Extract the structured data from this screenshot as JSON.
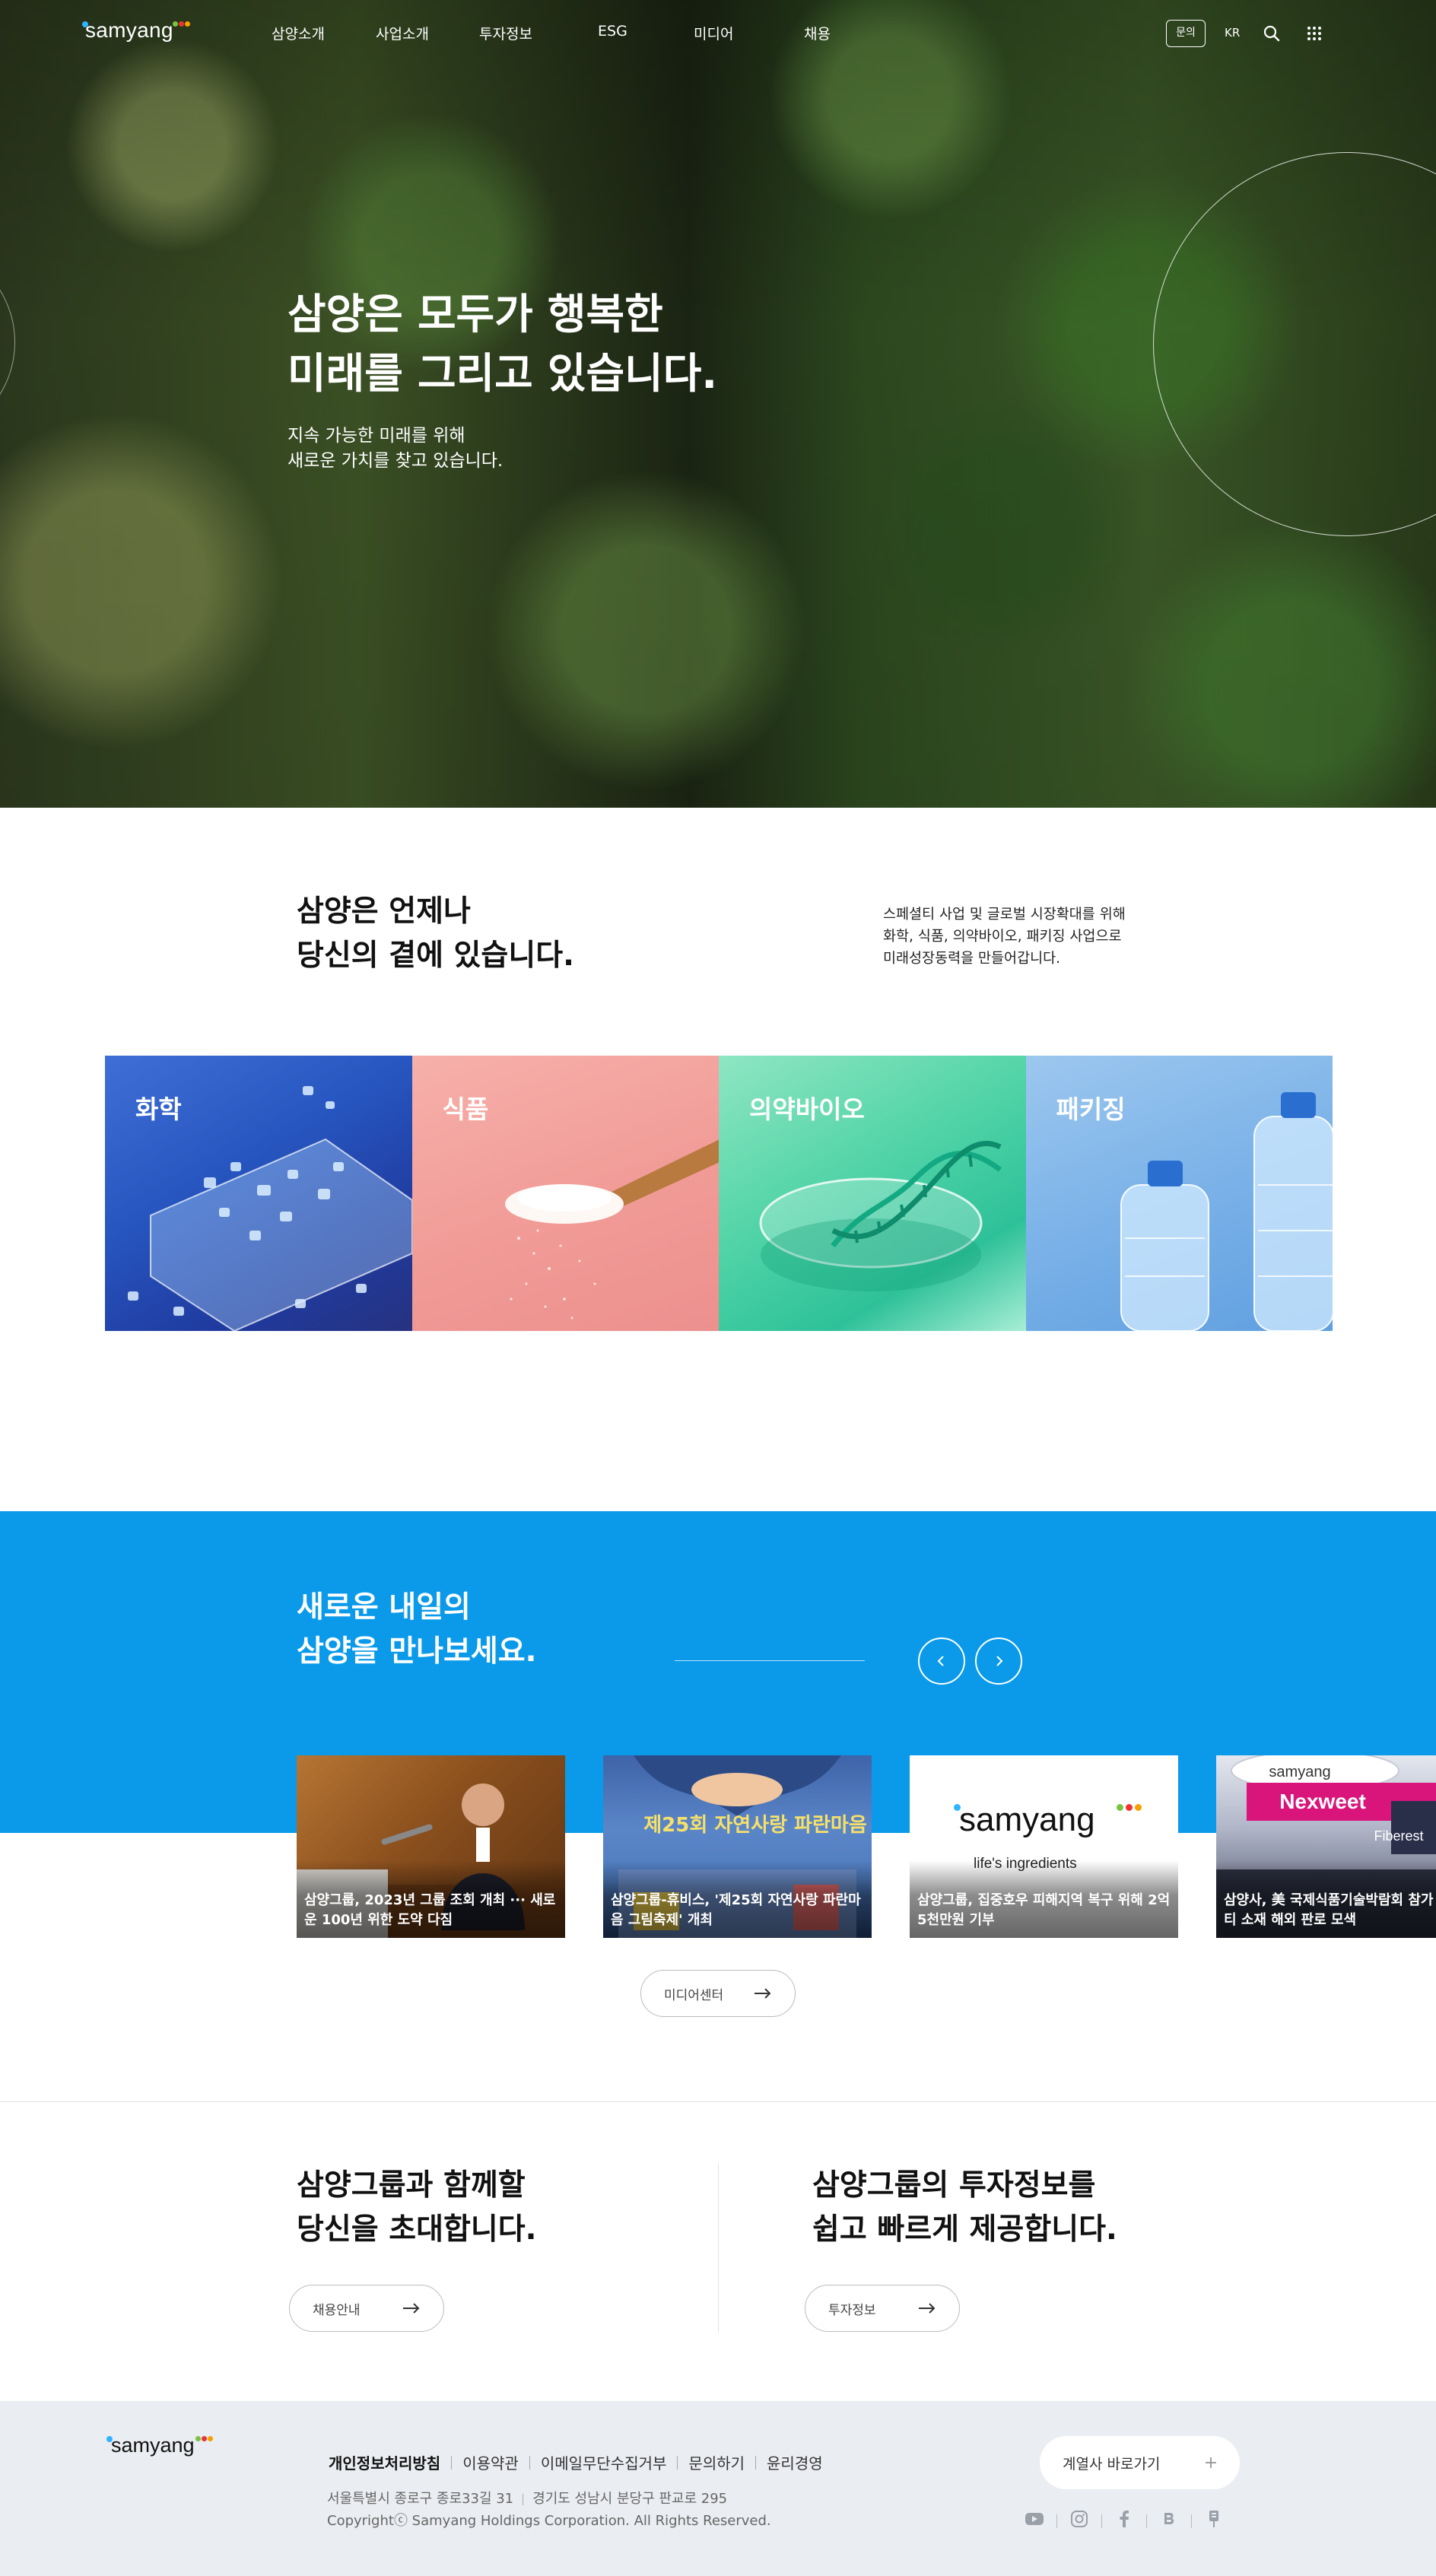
{
  "brand": {
    "logo_text": "samyang",
    "footer_logo_text": "samyang"
  },
  "nav": {
    "items": [
      "삼양소개",
      "사업소개",
      "투자정보",
      "ESG",
      "미디어",
      "채용"
    ],
    "inquiry_label": "문의",
    "lang_label": "KR",
    "search_icon": "search-icon",
    "menu_icon": "grid-menu-icon"
  },
  "hero": {
    "title_line1": "삼양은 모두가 행복한",
    "title_line2": "미래를 그리고 있습니다.",
    "sub_line1": "지속 가능한 미래를 위해",
    "sub_line2": "새로운 가치를 찾고 있습니다."
  },
  "about": {
    "title_line1": "삼양은 언제나",
    "title_line2": "당신의 곁에 있습니다.",
    "desc_line1": "스페셜티 사업 및 글로벌 시장확대를 위해",
    "desc_line2": "화학, 식품, 의약바이오, 패키징 사업으로",
    "desc_line3": "미래성장동력을 만들어갑니다."
  },
  "business": [
    {
      "label": "화학"
    },
    {
      "label": "식품"
    },
    {
      "label": "의약바이오"
    },
    {
      "label": "패키징"
    }
  ],
  "media": {
    "title_line1": "새로운 내일의",
    "title_line2": "삼양을 만나보세요.",
    "news": [
      {
        "caption": "삼양그룹, 2023년 그룹 조회 개최 ··· 새로운 100년 위한 도약 다짐"
      },
      {
        "caption": "삼양그룹-휴비스, '제25회 자연사랑 파란마음 그림축제' 개최",
        "image_text": "제25회 자연사랑 파란마음"
      },
      {
        "caption": "삼양그룹, 집중호우 피해지역 복구 위해 2억5천만원 기부",
        "image_logo": "samyang",
        "image_tagline": "life's ingredients"
      },
      {
        "caption": "삼양사, 美 국제식품기술박람회 참가 스페셜티 소재 해외 판로 모색",
        "image_text_1": "samyang",
        "image_text_2": "Nexweet",
        "image_text_3": "Fiberest"
      }
    ],
    "center_button": "미디어센터"
  },
  "invite": {
    "recruit_title_line1": "삼양그룹과 함께할",
    "recruit_title_line2": "당신을 초대합니다.",
    "recruit_button": "채용안내",
    "ir_title_line1": "삼양그룹의 투자정보를",
    "ir_title_line2": "쉽고 빠르게 제공합니다.",
    "ir_button": "투자정보"
  },
  "footer": {
    "links": [
      "개인정보처리방침",
      "이용약관",
      "이메일무단수집거부",
      "문의하기",
      "윤리경영"
    ],
    "address_1": "서울특별시 종로구 종로33길 31",
    "address_2": "경기도 성남시 분당구 판교로 295",
    "copyright": "Copyrightⓒ Samyang Holdings Corporation. All Rights Reserved.",
    "family_label": "계열사 바로가기",
    "social": [
      "youtube-icon",
      "instagram-icon",
      "facebook-icon",
      "blog-icon",
      "post-icon"
    ]
  },
  "colors": {
    "accent": "#0a9ae9",
    "footer_bg": "#eaedf1"
  }
}
